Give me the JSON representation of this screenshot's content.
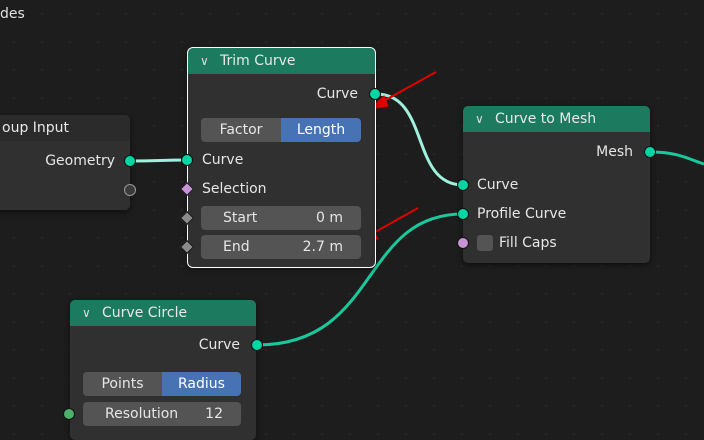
{
  "editor": {
    "title": "des"
  },
  "nodes": {
    "group_input": {
      "title": "oup Input",
      "output_geometry": "Geometry"
    },
    "trim_curve": {
      "title": "Trim Curve",
      "output_curve": "Curve",
      "mode_options": [
        "Factor",
        "Length"
      ],
      "mode_selected": "Length",
      "input_curve": "Curve",
      "input_selection": "Selection",
      "start_label": "Start",
      "start_value": "0 m",
      "end_label": "End",
      "end_value": "2.7 m"
    },
    "curve_to_mesh": {
      "title": "Curve to Mesh",
      "output_mesh": "Mesh",
      "input_curve": "Curve",
      "input_profile": "Profile Curve",
      "input_fill_caps": "Fill Caps"
    },
    "curve_circle": {
      "title": "Curve Circle",
      "output_curve": "Curve",
      "mode_options": [
        "Points",
        "Radius"
      ],
      "mode_selected": "Radius",
      "resolution_label": "Resolution",
      "resolution_value": "12"
    }
  },
  "colors": {
    "geometry_socket": "#00d6a3",
    "geometry_header": "#1c7a5f",
    "annotation_arrow": "#e00000",
    "active_option": "#4772b3"
  }
}
